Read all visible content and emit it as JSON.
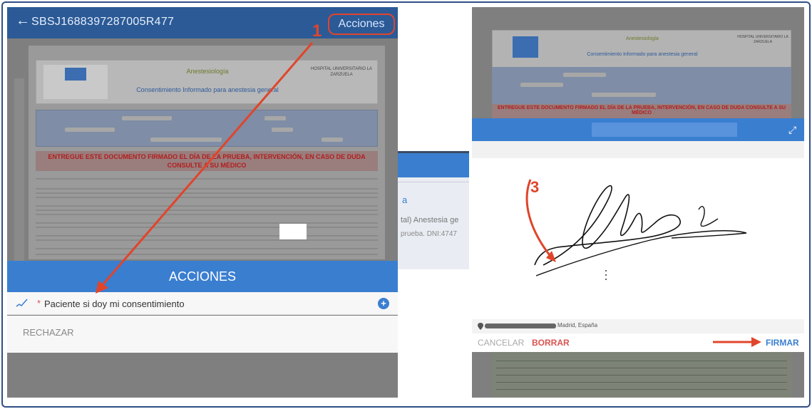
{
  "left": {
    "doc_id": "SBSJ1688397287005R477",
    "acciones_top": "Acciones",
    "callout": "1",
    "form": {
      "specialty": "Anestesiología",
      "consent_title": "Consentimiento Informado para anestesia general",
      "hospital": "HOSPITAL UNIVERSITARIO LA ZARZUELA",
      "warning": "ENTREGUE ESTE DOCUMENTO FIRMADO EL DÍA DE LA PRUEBA, INTERVENCIÓN, EN CASO DE DUDA CONSULTE A SU MÉDICO"
    },
    "actions_title": "ACCIONES",
    "action_item": "Paciente si doy mi consentimiento",
    "required_mark": "*",
    "plus": "+",
    "reject": "RECHAZAR"
  },
  "middle": {
    "a": "a",
    "line1": "tal) Anestesia ge",
    "line2": "prueba. DNI:4747"
  },
  "right": {
    "callout": "3",
    "location": "Madrid, España",
    "cancel": "CANCELAR",
    "borrar": "BORRAR",
    "firmar": "FIRMAR"
  },
  "colors": {
    "accent_blue": "#3a7ed0",
    "callout_red": "#e0452b",
    "header_blue": "#2b5a96"
  }
}
